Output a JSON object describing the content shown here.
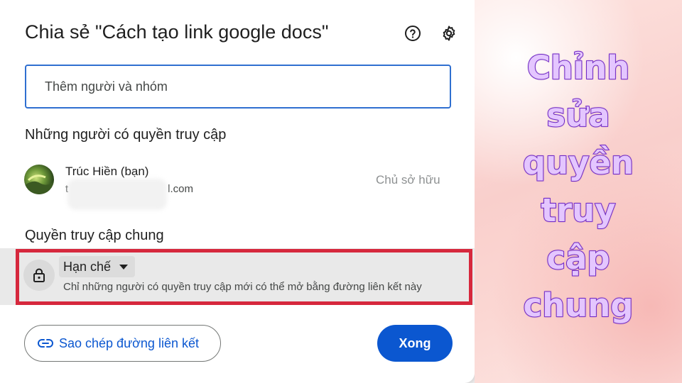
{
  "dialog": {
    "title": "Chia sẻ \"Cách tạo link google docs\"",
    "icons": {
      "help": "help-circle-icon",
      "settings": "gear-icon"
    },
    "add_people": {
      "placeholder": "Thêm người và nhóm"
    },
    "people_section_title": "Những người có quyền truy cập",
    "user": {
      "name": "Trúc Hiền (bạn)",
      "email_visible_prefix": "t",
      "email_visible_suffix": "l.com",
      "role": "Chủ sở hữu",
      "avatar": "user-avatar"
    },
    "general_access": {
      "section_title": "Quyền truy cập chung",
      "icon": "lock-icon",
      "selected": "Hạn chế",
      "description": "Chỉ những người có quyền truy cập mới có thể mở bằng đường liên kết này",
      "highlight_color": "#d6283d"
    },
    "buttons": {
      "copy_link": "Sao chép đường liên kết",
      "copy_link_icon": "link-icon",
      "done": "Xong"
    },
    "colors": {
      "accent": "#0b57d0",
      "input_border": "#2f6fd0"
    }
  },
  "overlay": {
    "caption": "Chỉnh\nsửa\nquyền\ntruy\ncập\nchung",
    "text_color": "#e4c6ff",
    "stroke_color": "#7a2fd0"
  }
}
